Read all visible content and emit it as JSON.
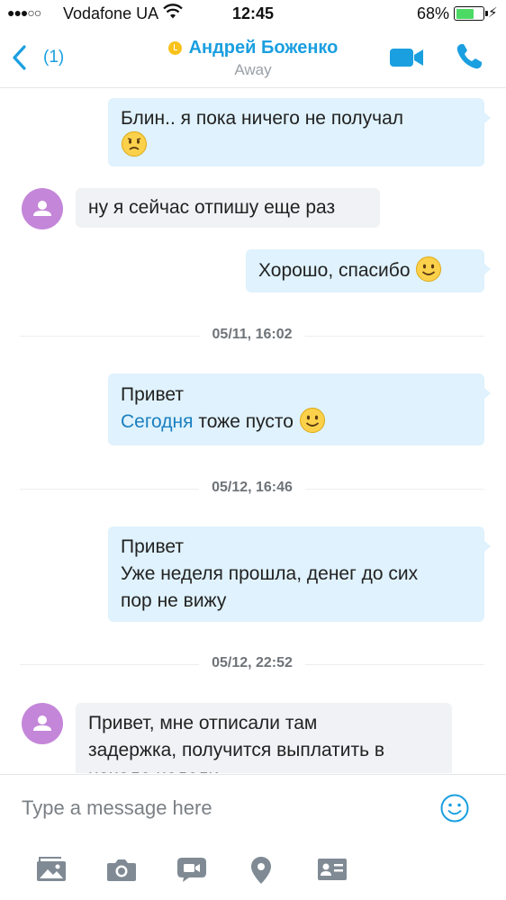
{
  "status_bar": {
    "signal": "●●●○○",
    "carrier": "Vodafone UA",
    "time": "12:45",
    "battery_percent": "68%",
    "battery_level": 0.68
  },
  "header": {
    "back_count": "(1)",
    "contact_name": "Андрей Боженко",
    "presence": "Away",
    "accent_color": "#1a9fe0",
    "status_color": "#f8c21b"
  },
  "messages": [
    {
      "direction": "out",
      "text": "Блин.. я пока ничего не получал",
      "emoji": "sad-emoticon"
    },
    {
      "direction": "in",
      "text": "ну я сейчас отпишу еще раз"
    },
    {
      "direction": "out",
      "text": "Хорошо, спасибо",
      "emoji": "smile-emoticon"
    },
    {
      "type": "date",
      "text": "05/11, 16:02"
    },
    {
      "direction": "out",
      "line1": "Привет",
      "link": "Сегодня",
      "text": "тоже пусто",
      "emoji": "smile-emoticon"
    },
    {
      "type": "date",
      "text": "05/12, 16:46"
    },
    {
      "direction": "out",
      "line1": "Привет",
      "line2": "Уже неделя прошла, денег до сих",
      "line3": "пор не вижу"
    },
    {
      "type": "date",
      "text": "05/12, 22:52"
    },
    {
      "direction": "in",
      "line1": "Привет, мне отписали там",
      "line2": "задержка, получится выплатить в",
      "line3": "начале недели"
    }
  ],
  "composer": {
    "placeholder": "Type a message here",
    "toolbar": [
      "gallery-icon",
      "camera-icon",
      "video-message-icon",
      "location-icon",
      "contact-card-icon"
    ]
  }
}
